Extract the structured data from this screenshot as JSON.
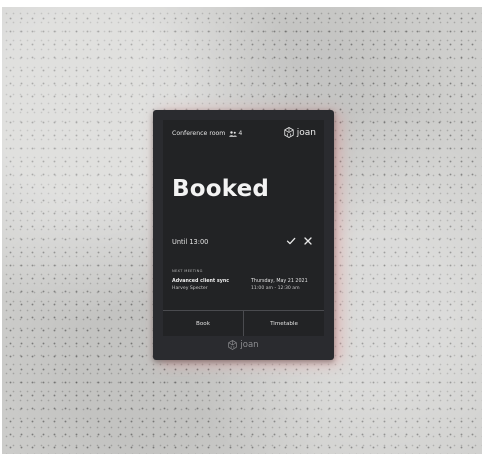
{
  "header": {
    "room_name": "Conference room",
    "capacity": "4",
    "capacity_icon": "people-icon",
    "brand": "joan",
    "brand_icon": "joan-logo-icon"
  },
  "status": {
    "title": "Booked",
    "until": "Until 13:00",
    "confirm_icon": "check-icon",
    "cancel_icon": "close-icon"
  },
  "next_meeting": {
    "label": "NEXT MEETING",
    "title": "Advanced client sync",
    "host": "Harvey Specter",
    "date": "Thursday, May 21 2021",
    "time": "11:00 am - 12:30 am"
  },
  "footer": {
    "book_label": "Book",
    "timetable_label": "Timetable"
  },
  "bezel": {
    "brand": "joan"
  },
  "colors": {
    "screen": "#222325",
    "frame": "#2a2b2f",
    "wall": "#cfcfcd",
    "glow": "#e67878"
  }
}
